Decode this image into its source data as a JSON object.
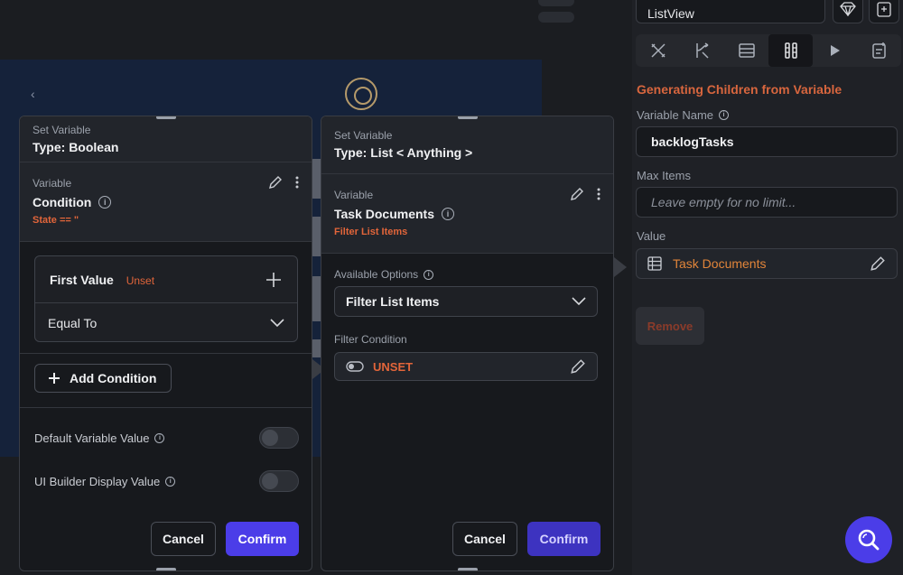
{
  "side_panel": {
    "widget_name": "ListView",
    "heading": "Generating Children from Variable",
    "variable_name_label": "Variable Name",
    "variable_name_value": "backlogTasks",
    "max_items_label": "Max Items",
    "max_items_placeholder": "Leave empty for no limit...",
    "value_label": "Value",
    "value_value": "Task Documents",
    "remove_label": "Remove",
    "tabs": [
      "properties-icon",
      "actions-icon",
      "backend-query-icon",
      "generate-children-icon",
      "play-icon",
      "document-icon"
    ]
  },
  "left_panel": {
    "header_small": "Set Variable",
    "header_type": "Type: Boolean",
    "variable_small": "Variable",
    "variable_name": "Condition",
    "variable_sub": "State == \"",
    "first_value_label": "First Value",
    "first_value_status": "Unset",
    "operator": "Equal To",
    "add_condition_label": "Add Condition",
    "default_value_label": "Default Variable Value",
    "ui_builder_label": "UI Builder Display Value",
    "cancel_label": "Cancel",
    "confirm_label": "Confirm"
  },
  "right_panel": {
    "header_small": "Set Variable",
    "header_type": "Type: List < Anything >",
    "variable_small": "Variable",
    "variable_name": "Task Documents",
    "variable_sub": "Filter List Items",
    "available_options_label": "Available Options",
    "available_options_value": "Filter List Items",
    "filter_condition_label": "Filter Condition",
    "filter_condition_value": "UNSET",
    "cancel_label": "Cancel",
    "confirm_label": "Confirm"
  },
  "colors": {
    "accent": "#4b3de8",
    "warning": "#e2653a",
    "heading": "#d8663e"
  }
}
